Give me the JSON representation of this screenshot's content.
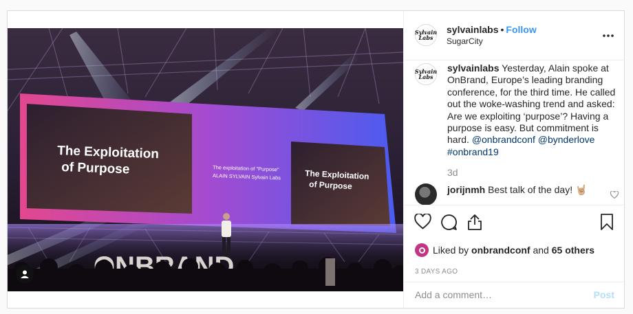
{
  "post": {
    "username": "sylvainlabs",
    "follow_label": "Follow",
    "location": "SugarCity",
    "logo_text": "Sylvain Labs",
    "more_label": "•••",
    "caption_user": "sylvainlabs",
    "caption_text": "Yesterday, Alain spoke at OnBrand, Europe’s leading branding conference, for the third time. He called out the woke-washing trend and asked: Are we exploiting ‘purpose’? Having a purpose is easy. But commitment is hard.",
    "caption_tags": [
      "@onbrandconf",
      "@bynderlove",
      "#onbrand19"
    ],
    "caption_time": "3d",
    "comment": {
      "user": "jorijnmh",
      "text": "Best talk of the day! 🤘🏼"
    },
    "likes": {
      "prefix": "Liked by",
      "user": "onbrandconf",
      "and": "and",
      "others": "65 others"
    },
    "date": "3 DAYS AGO",
    "add_comment_placeholder": "Add a comment…",
    "post_label": "Post"
  },
  "photo": {
    "screen_left_line1": "The Exploitation",
    "screen_left_line2": "of Purpose",
    "screen_mid_line1": "The exploitation of \"Purpose\"",
    "screen_mid_line2": "ALAIN SYLVAIN Sylvain Labs",
    "screen_right_line1": "The Exploitation",
    "screen_right_line2": "of Purpose",
    "stage_letters": "ONBRAND"
  },
  "colors": {
    "accent": "#3897f0",
    "link": "#00376b",
    "muted": "#8e8e8e",
    "post_disabled": "#b2dffc",
    "border": "#dbdbdb"
  }
}
